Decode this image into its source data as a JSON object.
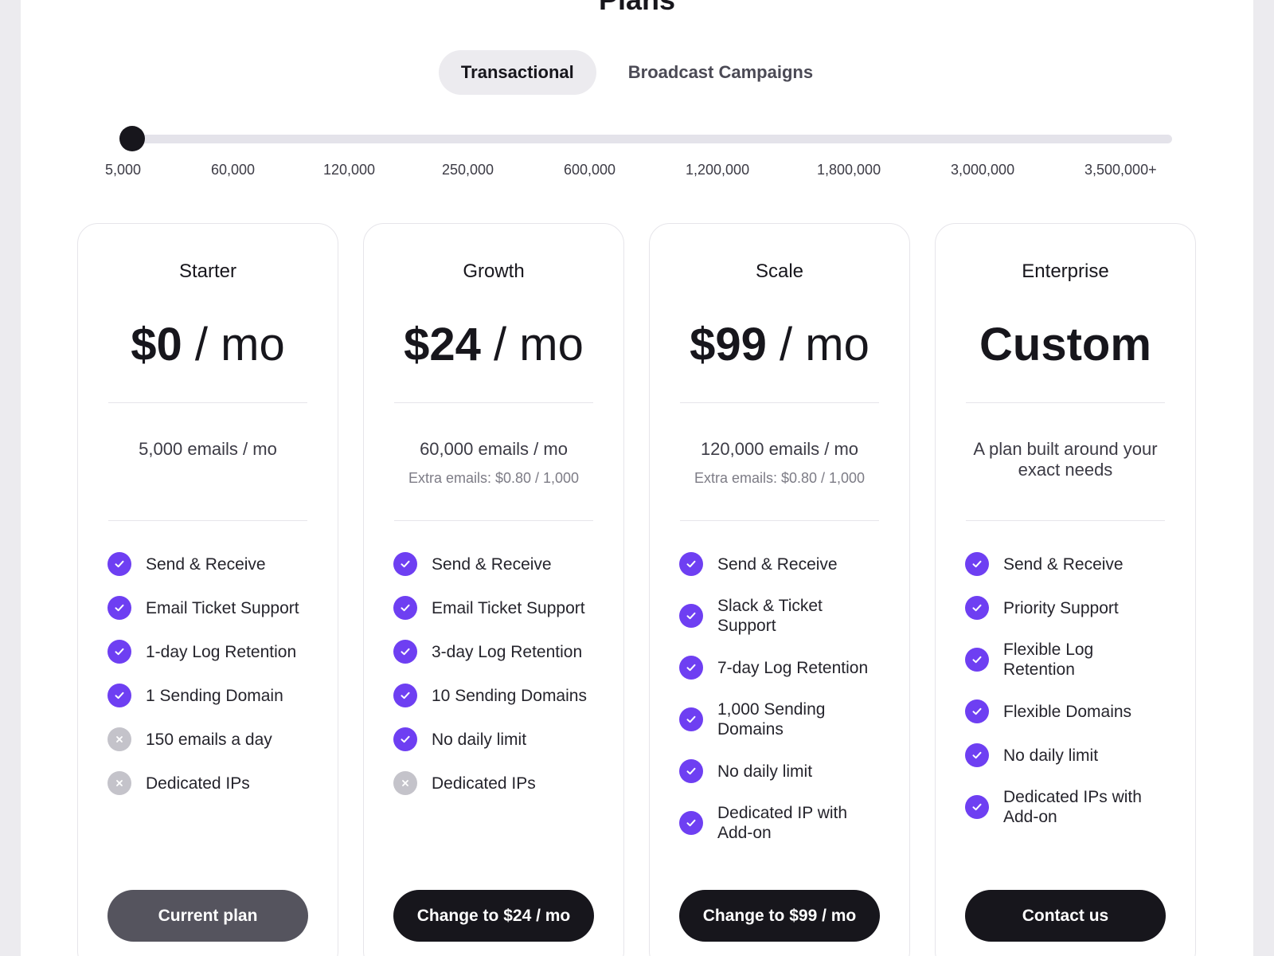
{
  "page": {
    "title": "Plans"
  },
  "tabs": [
    {
      "label": "Transactional",
      "active": true
    },
    {
      "label": "Broadcast Campaigns",
      "active": false
    }
  ],
  "slider": {
    "ticks": [
      "5,000",
      "60,000",
      "120,000",
      "250,000",
      "600,000",
      "1,200,000",
      "1,800,000",
      "3,000,000",
      "3,500,000+"
    ],
    "selected": "5,000"
  },
  "colors": {
    "accent": "#6e3ff2",
    "dark": "#17161c",
    "muted": "#c4c3ca",
    "current_button": "#55545e"
  },
  "plans": [
    {
      "name": "Starter",
      "price_amount": "$0",
      "price_unit": "/ mo",
      "allowance": "5,000 emails / mo",
      "extra": "",
      "features": [
        {
          "text": "Send & Receive",
          "included": true,
          "icon": "check-icon"
        },
        {
          "text": "Email Ticket Support",
          "included": true,
          "icon": "check-icon"
        },
        {
          "text": "1-day Log Retention",
          "included": true,
          "icon": "check-icon"
        },
        {
          "text": "1 Sending Domain",
          "included": true,
          "icon": "check-icon"
        },
        {
          "text": "150 emails a day",
          "included": false,
          "icon": "cross-icon"
        },
        {
          "text": "Dedicated IPs",
          "included": false,
          "icon": "cross-icon"
        }
      ],
      "button": "Current plan"
    },
    {
      "name": "Growth",
      "price_amount": "$24",
      "price_unit": "/ mo",
      "allowance": "60,000 emails / mo",
      "extra": "Extra emails: $0.80 / 1,000",
      "features": [
        {
          "text": "Send & Receive",
          "included": true,
          "icon": "check-icon"
        },
        {
          "text": "Email Ticket Support",
          "included": true,
          "icon": "check-icon"
        },
        {
          "text": "3-day Log Retention",
          "included": true,
          "icon": "check-icon"
        },
        {
          "text": "10 Sending Domains",
          "included": true,
          "icon": "check-icon"
        },
        {
          "text": "No daily limit",
          "included": true,
          "icon": "check-icon"
        },
        {
          "text": "Dedicated IPs",
          "included": false,
          "icon": "cross-icon"
        }
      ],
      "button": "Change to $24 / mo"
    },
    {
      "name": "Scale",
      "price_amount": "$99",
      "price_unit": "/ mo",
      "allowance": "120,000 emails / mo",
      "extra": "Extra emails: $0.80 / 1,000",
      "features": [
        {
          "text": "Send & Receive",
          "included": true,
          "icon": "check-icon"
        },
        {
          "text": "Slack & Ticket Support",
          "included": true,
          "icon": "check-icon"
        },
        {
          "text": "7-day Log Retention",
          "included": true,
          "icon": "check-icon"
        },
        {
          "text": "1,000 Sending Domains",
          "included": true,
          "icon": "check-icon"
        },
        {
          "text": "No daily limit",
          "included": true,
          "icon": "check-icon"
        },
        {
          "text": "Dedicated IP with Add-on",
          "included": true,
          "icon": "check-icon"
        }
      ],
      "button": "Change to $99 / mo"
    },
    {
      "name": "Enterprise",
      "price_amount": "Custom",
      "price_unit": "",
      "allowance": "A plan built around your exact needs",
      "extra": "",
      "features": [
        {
          "text": "Send & Receive",
          "included": true,
          "icon": "check-icon"
        },
        {
          "text": "Priority Support",
          "included": true,
          "icon": "check-icon"
        },
        {
          "text": "Flexible Log Retention",
          "included": true,
          "icon": "check-icon"
        },
        {
          "text": "Flexible Domains",
          "included": true,
          "icon": "check-icon"
        },
        {
          "text": "No daily limit",
          "included": true,
          "icon": "check-icon"
        },
        {
          "text": "Dedicated IPs with Add-on",
          "included": true,
          "icon": "check-icon"
        }
      ],
      "button": "Contact us"
    }
  ]
}
